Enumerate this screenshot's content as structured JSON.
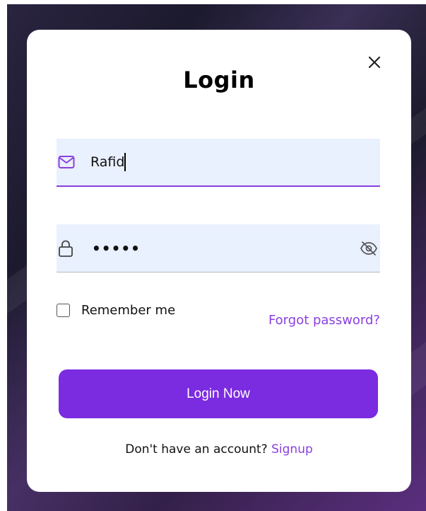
{
  "modal": {
    "title": "Login",
    "close_icon": "close-icon"
  },
  "email": {
    "icon": "mail-icon",
    "value": "Rafid",
    "accent": "#8a3fe0"
  },
  "password": {
    "icon": "lock-icon",
    "masked_value": "•••••",
    "toggle_icon": "eye-off-icon"
  },
  "remember": {
    "label": "Remember me",
    "checked": false
  },
  "forgot": {
    "label": "Forgot password?"
  },
  "login_button": {
    "label": "Login Now",
    "color": "#7b2be0"
  },
  "signup": {
    "prompt": "Don't have an account?",
    "link": "Signup"
  },
  "colors": {
    "field_bg": "#e9f0fe",
    "accent": "#8a3fe0"
  }
}
